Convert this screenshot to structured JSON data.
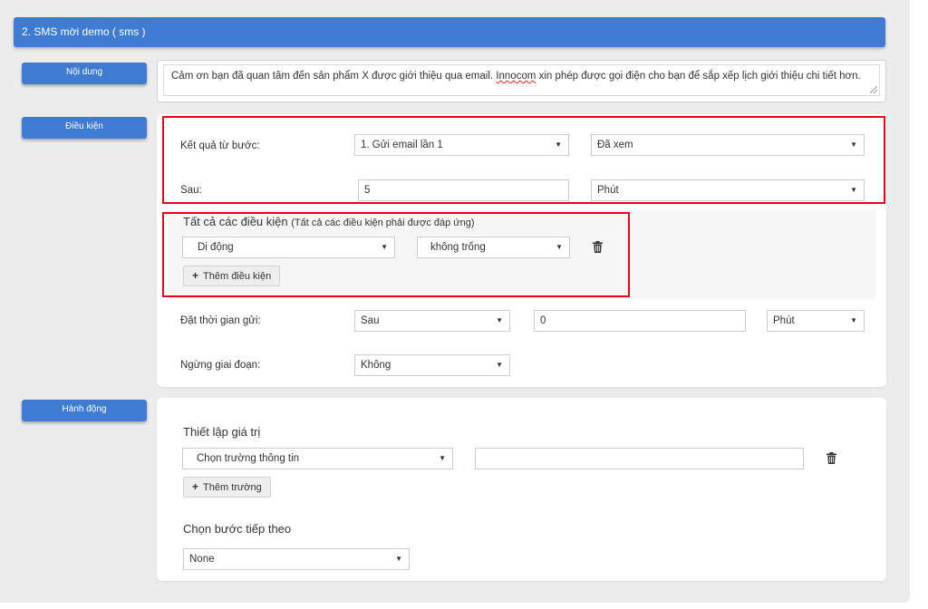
{
  "section": {
    "title": "2. SMS mời demo ( sms )"
  },
  "noi_dung": {
    "tab_label": "Nội dung",
    "message_before": "Cảm ơn bạn đã quan tâm đến sản phẩm X được giới thiệu qua email. ",
    "message_misspelled": "Innocom",
    "message_after": " xin phép được gọi điện cho bạn để sắp xếp lịch giới thiệu chi tiết hơn."
  },
  "dieu_kien": {
    "tab_label": "Điều kiện",
    "ket_qua_label": "Kết quả từ bước:",
    "ket_qua_step": "1. Gửi email lần 1",
    "ket_qua_status": "Đã xem",
    "sau_label": "Sau:",
    "sau_value": "5",
    "sau_unit": "Phút",
    "all_conditions_title": "Tất cả các điều kiện",
    "all_conditions_note": "(Tất cả các điều kiện phải được đáp ứng)",
    "condition_field": "Di động",
    "condition_operator": "không trống",
    "add_condition_label": "Thêm điều kiện",
    "dat_thoi_gian_label": "Đặt thời gian gửi:",
    "dat_thoi_gian_mode": "Sau",
    "dat_thoi_gian_value": "0",
    "dat_thoi_gian_unit": "Phút",
    "ngung_label": "Ngừng giai đoạn:",
    "ngung_value": "Không"
  },
  "hanh_dong": {
    "tab_label": "Hành động",
    "thiet_lap_title": "Thiết lập giá trị",
    "field_select": "Chọn trường thông tin",
    "field_value": "",
    "add_field_label": "Thêm trường",
    "next_step_title": "Chọn bước tiếp theo",
    "next_step_value": "None"
  },
  "colors": {
    "accent": "#3e7bd1",
    "highlight": "#e8001c",
    "background": "#ececec"
  },
  "icons": {
    "caret": "caret-down-icon",
    "trash": "trash-icon",
    "plus": "plus-icon"
  }
}
